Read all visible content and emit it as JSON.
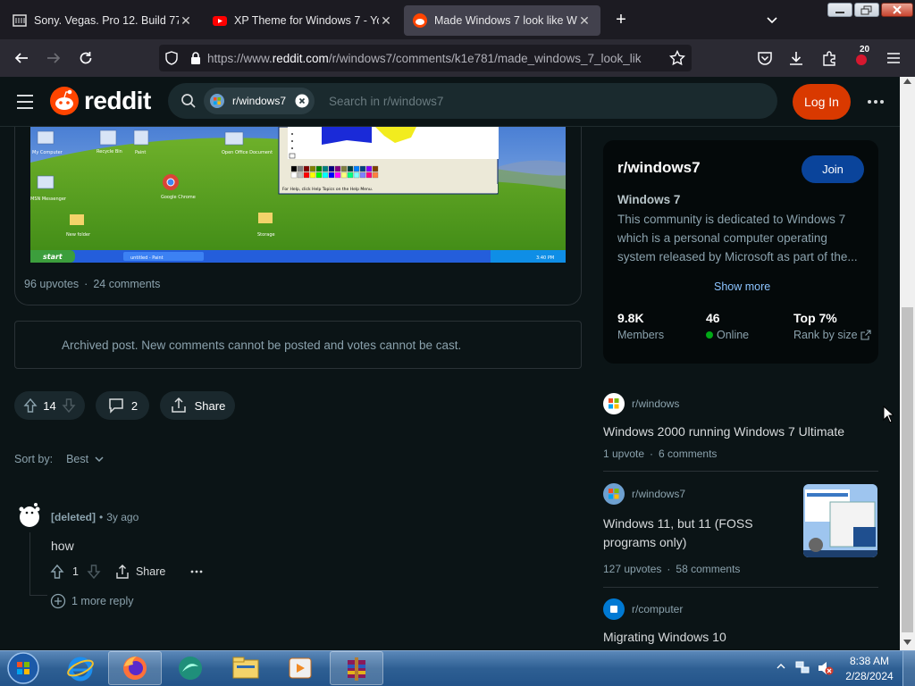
{
  "browser": {
    "tabs": [
      {
        "title": "Sony. Vegas. Pro 12. Build 770.6",
        "icon": "archive-icon"
      },
      {
        "title": "XP Theme for Windows 7 - You",
        "icon": "youtube-icon"
      },
      {
        "title": "Made Windows 7 look like Win",
        "icon": "reddit-icon"
      }
    ],
    "url_prefix": "https://www.",
    "url_domain": "reddit.com",
    "url_path": "/r/windows7/comments/k1e781/made_windows_7_look_lik",
    "extensions_badge": "20"
  },
  "header": {
    "brand": "reddit",
    "search_chip": "r/windows7",
    "search_placeholder": "Search in r/windows7",
    "login_label": "Log In"
  },
  "post": {
    "upvotes_text": "96 upvotes",
    "comments_text": "24 comments",
    "archived_notice": "Archived post. New comments cannot be posted and votes cannot be cast.",
    "vote_count": "14",
    "comment_count": "2",
    "share_label": "Share",
    "sort_label": "Sort by:",
    "sort_value": "Best",
    "screenshot": {
      "start_label": "start",
      "task_label": "untitled - Paint",
      "clock": "3:40 PM",
      "paint_status": "For Help, click Help Topics on the Help Menu.",
      "desktop_icons": [
        "My Computer",
        "Recycle Bin",
        "Paint",
        "Open Office Document",
        "MSN Messenger",
        "Google Chrome",
        "New folder",
        "Storage"
      ]
    }
  },
  "comment": {
    "author": "[deleted]",
    "age": "3y ago",
    "body": "how",
    "votes": "1",
    "share_label": "Share",
    "more_replies": "1 more reply"
  },
  "sidebar": {
    "community_name": "r/windows7",
    "join_label": "Join",
    "title": "Windows 7",
    "description": "This community is dedicated to Windows 7 which is a personal computer operating system released by Microsoft as part of the...",
    "show_more": "Show more",
    "stats": [
      {
        "value": "9.8K",
        "label": "Members"
      },
      {
        "value": "46",
        "label": "Online"
      },
      {
        "value": "Top 7%",
        "label": "Rank by size"
      }
    ],
    "related": [
      {
        "sub": "r/windows",
        "title": "Windows 2000 running Windows 7 Ultimate",
        "upvotes": "1 upvote",
        "comments": "6 comments"
      },
      {
        "sub": "r/windows7",
        "title": "Windows 11, but 11 (FOSS programs only)",
        "upvotes": "127 upvotes",
        "comments": "58 comments"
      },
      {
        "sub": "r/computer",
        "title": "Migrating Windows 10",
        "upvotes": "",
        "comments": ""
      }
    ]
  },
  "taskbar": {
    "time": "8:38 AM",
    "date": "2/28/2024"
  },
  "colors": {
    "reddit_orange": "#ff4500",
    "login_bg": "#d93900",
    "join_bg": "#0a449b",
    "online_green": "#01a816"
  }
}
